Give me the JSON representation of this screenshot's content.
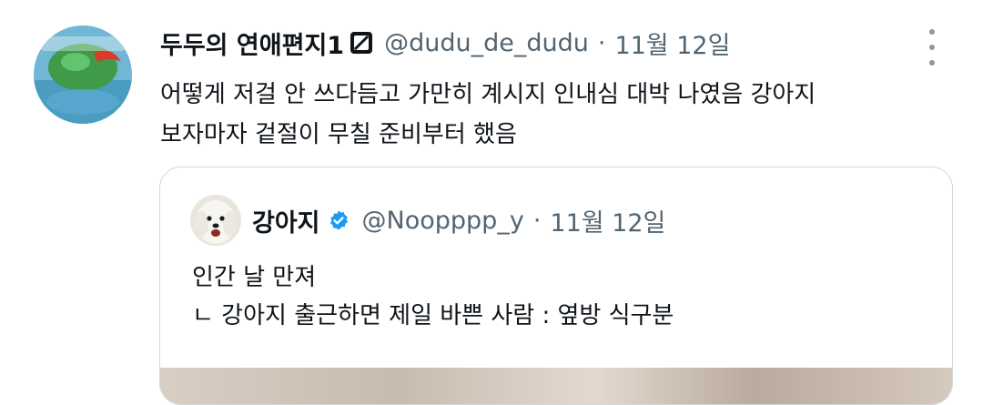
{
  "tweet": {
    "display_name": "두두의 연애편지1",
    "handle": "@dudu_de_dudu",
    "separator": "·",
    "date": "11월 12일",
    "more_icon": "more-horizontal-icon",
    "text_lines": [
      "어떻게 저걸 안 쓰다듬고 가만히 계시지 인내심 대박 나였음 강아지",
      "보자마자 겉절이 무칠 준비부터 했음"
    ]
  },
  "quote": {
    "display_name": "강아지",
    "handle": "@Noopppp_y",
    "separator": "·",
    "date": "11월 12일",
    "verified_icon": "verified-badge-icon",
    "verified_color": "#1d9bf0",
    "text_lines": [
      "인간 날 만져",
      "ㄴ 강아지 출근하면 제일 바쁜 사람 : 옆방 식구분"
    ]
  }
}
